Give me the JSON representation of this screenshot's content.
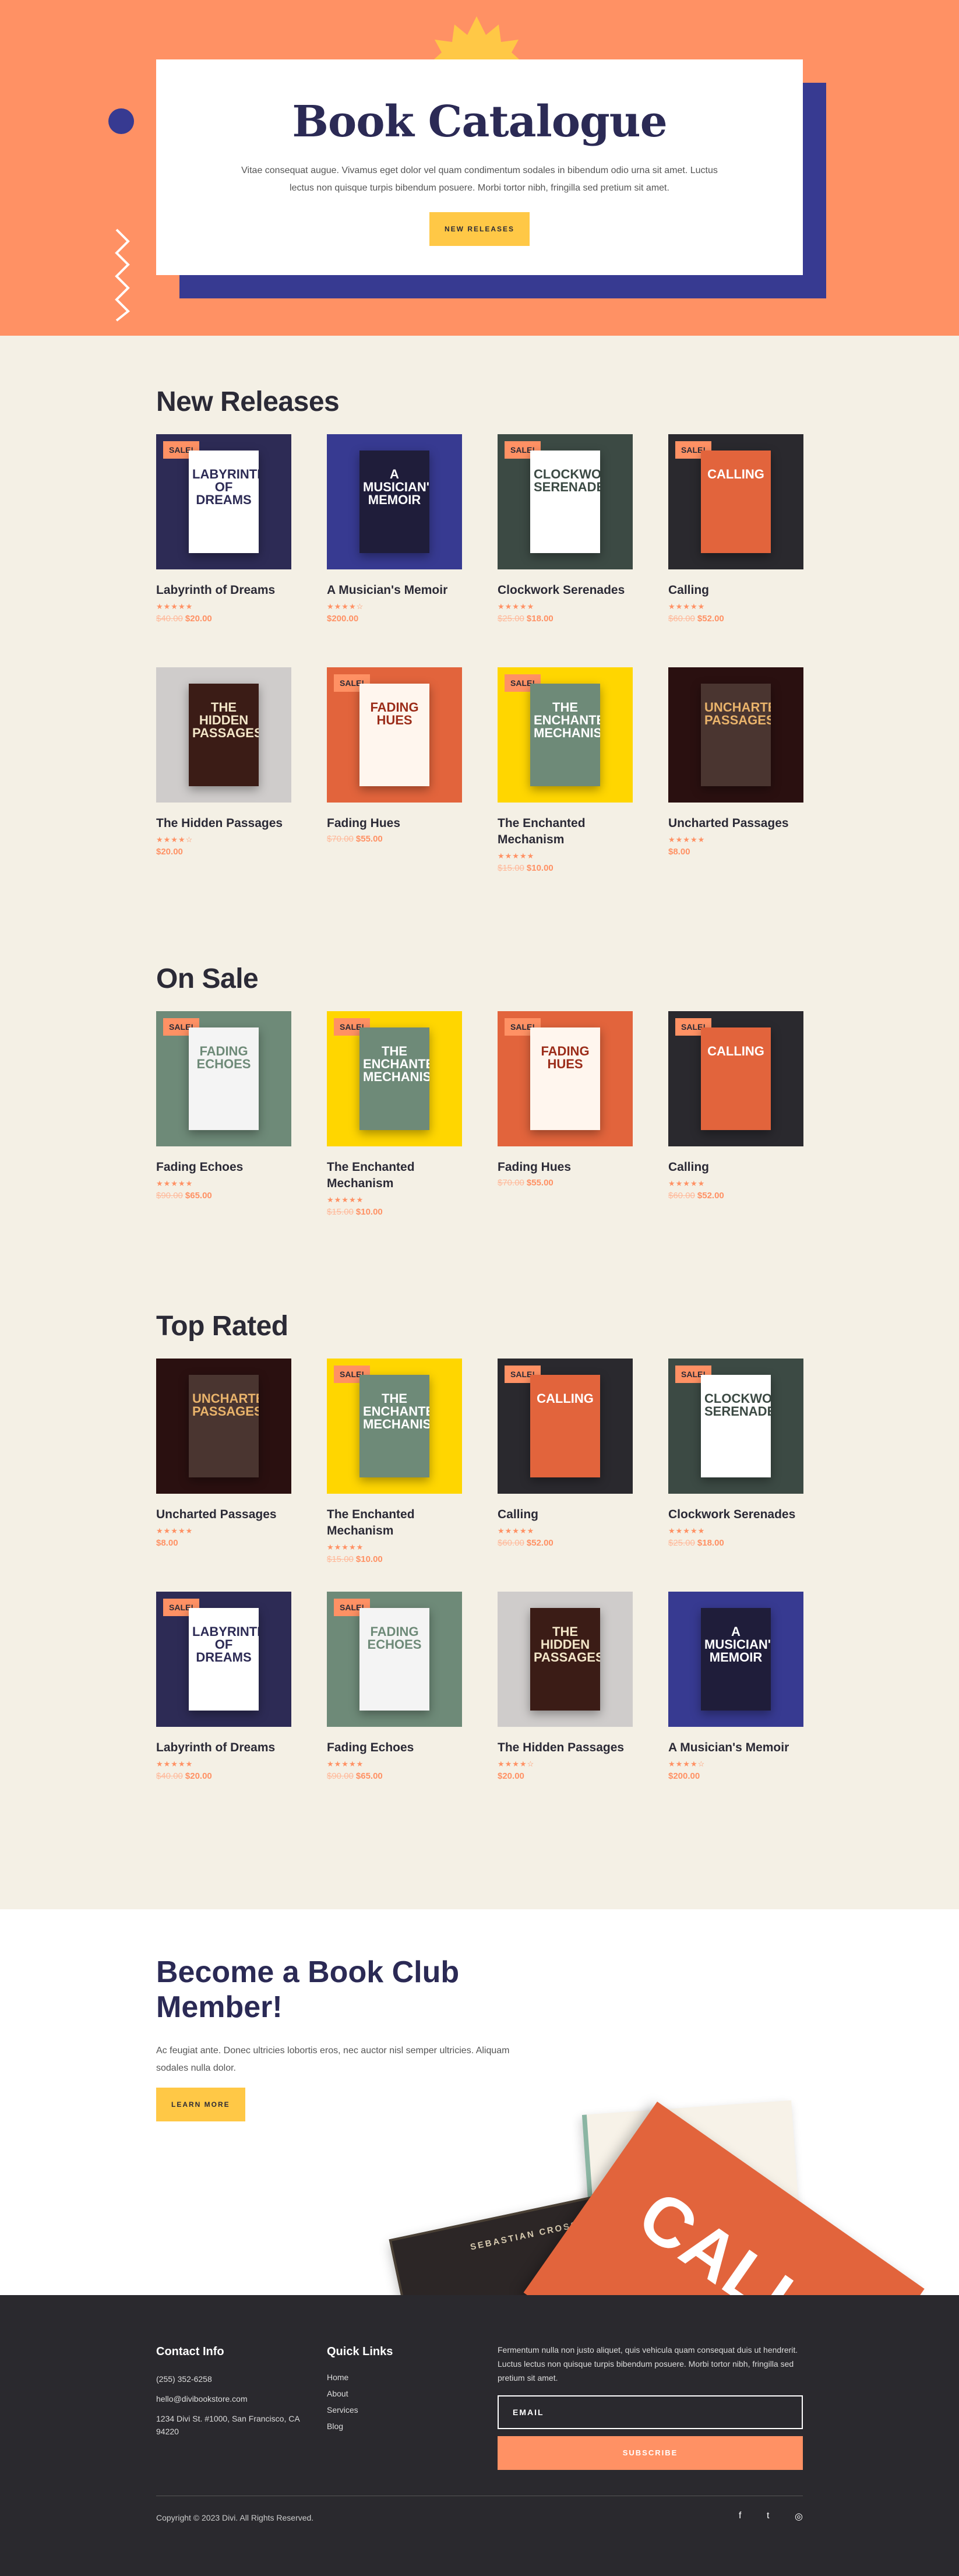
{
  "hero": {
    "title": "Book Catalogue",
    "text": "Vitae consequat augue. Vivamus eget dolor vel quam condimentum sodales in bibendum odio urna sit amet. Luctus lectus non quisque turpis bibendum posuere. Morbi tortor nibh, fringilla sed pretium sit amet.",
    "button": "NEW RELEASES"
  },
  "sale_label": "SALE!",
  "sections": [
    {
      "title": "New Releases",
      "products": [
        {
          "title": "Labyrinth of Dreams",
          "cover": "Labyrinth Of Dreams",
          "bg": "#2d2b55",
          "book": "#ffffff",
          "ink": "#2d2b55",
          "sale": true,
          "stars": "★★★★★",
          "old": "$40.00",
          "price": "$20.00"
        },
        {
          "title": "A Musician's Memoir",
          "cover": "A Musician's Memoir",
          "bg": "#373a91",
          "book": "#1f1d3a",
          "ink": "#ffffff",
          "sale": false,
          "stars": "★★★★☆",
          "old": "",
          "price": "$200.00"
        },
        {
          "title": "Clockwork Serenades",
          "cover": "Clockwork Serenades",
          "bg": "#3c4a44",
          "book": "#ffffff",
          "ink": "#3c4a44",
          "sale": true,
          "stars": "★★★★★",
          "old": "$25.00",
          "price": "$18.00"
        },
        {
          "title": "Calling",
          "cover": "Calling",
          "bg": "#2a292e",
          "book": "#e2643c",
          "ink": "#ffffff",
          "sale": true,
          "stars": "★★★★★",
          "old": "$60.00",
          "price": "$52.00"
        },
        {
          "title": "The Hidden Passages",
          "cover": "The Hidden Passages",
          "bg": "#cfcccb",
          "book": "#3b1c16",
          "ink": "#f3e6c8",
          "sale": false,
          "stars": "★★★★☆",
          "old": "",
          "price": "$20.00"
        },
        {
          "title": "Fading Hues",
          "cover": "Fading Hues",
          "bg": "#e2643c",
          "book": "#fff6ee",
          "ink": "#9b2d1a",
          "sale": true,
          "stars": "",
          "old": "$70.00",
          "price": "$55.00"
        },
        {
          "title": "The Enchanted Mechanism",
          "cover": "The Enchanted Mechanism",
          "bg": "#ffd600",
          "book": "#6e8a78",
          "ink": "#ffffff",
          "sale": true,
          "stars": "★★★★★",
          "old": "$15.00",
          "price": "$10.00"
        },
        {
          "title": "Uncharted Passages",
          "cover": "Uncharted Passages",
          "bg": "#2a1010",
          "book": "#4a3530",
          "ink": "#e9b36b",
          "sale": false,
          "stars": "★★★★★",
          "old": "",
          "price": "$8.00"
        }
      ]
    },
    {
      "title": "On Sale",
      "products": [
        {
          "title": "Fading Echoes",
          "cover": "Fading Echoes",
          "bg": "#6e8a78",
          "book": "#f4f4f4",
          "ink": "#6e8a78",
          "sale": true,
          "stars": "★★★★★",
          "old": "$90.00",
          "price": "$65.00"
        },
        {
          "title": "The Enchanted Mechanism",
          "cover": "The Enchanted Mechanism",
          "bg": "#ffd600",
          "book": "#6e8a78",
          "ink": "#ffffff",
          "sale": true,
          "stars": "★★★★★",
          "old": "$15.00",
          "price": "$10.00"
        },
        {
          "title": "Fading Hues",
          "cover": "Fading Hues",
          "bg": "#e2643c",
          "book": "#fff6ee",
          "ink": "#9b2d1a",
          "sale": true,
          "stars": "",
          "old": "$70.00",
          "price": "$55.00"
        },
        {
          "title": "Calling",
          "cover": "Calling",
          "bg": "#2a292e",
          "book": "#e2643c",
          "ink": "#ffffff",
          "sale": true,
          "stars": "★★★★★",
          "old": "$60.00",
          "price": "$52.00"
        }
      ]
    },
    {
      "title": "Top Rated",
      "products": [
        {
          "title": "Uncharted Passages",
          "cover": "Uncharted Passages",
          "bg": "#2a1010",
          "book": "#4a3530",
          "ink": "#e9b36b",
          "sale": false,
          "stars": "★★★★★",
          "old": "",
          "price": "$8.00"
        },
        {
          "title": "The Enchanted Mechanism",
          "cover": "The Enchanted Mechanism",
          "bg": "#ffd600",
          "book": "#6e8a78",
          "ink": "#ffffff",
          "sale": true,
          "stars": "★★★★★",
          "old": "$15.00",
          "price": "$10.00"
        },
        {
          "title": "Calling",
          "cover": "Calling",
          "bg": "#2a292e",
          "book": "#e2643c",
          "ink": "#ffffff",
          "sale": true,
          "stars": "★★★★★",
          "old": "$60.00",
          "price": "$52.00"
        },
        {
          "title": "Clockwork Serenades",
          "cover": "Clockwork Serenades",
          "bg": "#3c4a44",
          "book": "#ffffff",
          "ink": "#3c4a44",
          "sale": true,
          "stars": "★★★★★",
          "old": "$25.00",
          "price": "$18.00"
        },
        {
          "title": "Labyrinth of Dreams",
          "cover": "Labyrinth Of Dreams",
          "bg": "#2d2b55",
          "book": "#ffffff",
          "ink": "#2d2b55",
          "sale": true,
          "stars": "★★★★★",
          "old": "$40.00",
          "price": "$20.00"
        },
        {
          "title": "Fading Echoes",
          "cover": "Fading Echoes",
          "bg": "#6e8a78",
          "book": "#f4f4f4",
          "ink": "#6e8a78",
          "sale": true,
          "stars": "★★★★★",
          "old": "$90.00",
          "price": "$65.00"
        },
        {
          "title": "The Hidden Passages",
          "cover": "The Hidden Passages",
          "bg": "#cfcccb",
          "book": "#3b1c16",
          "ink": "#f3e6c8",
          "sale": false,
          "stars": "★★★★☆",
          "old": "",
          "price": "$20.00"
        },
        {
          "title": "A Musician's Memoir",
          "cover": "A Musician's Memoir",
          "bg": "#373a91",
          "book": "#1f1d3a",
          "ink": "#ffffff",
          "sale": false,
          "stars": "★★★★☆",
          "old": "",
          "price": "$200.00"
        }
      ]
    }
  ],
  "club": {
    "title": "Become a Book Club Member!",
    "text": "Ac feugiat ante. Donec ultricies lobortis eros, nec auctor nisl semper ultricies. Aliquam sodales nulla dolor.",
    "button": "LEARN MORE",
    "book_red": "CALLING",
    "book_dark": "SEBASTIAN CROSS"
  },
  "footer": {
    "contact_title": "Contact Info",
    "phone": "(255) 352-6258",
    "email": "hello@divibookstore.com",
    "address": "1234 Divi St. #1000, San Francisco, CA 94220",
    "links_title": "Quick Links",
    "links": [
      "Home",
      "About",
      "Services",
      "Blog"
    ],
    "news_text": "Fermentum nulla non justo aliquet, quis vehicula quam consequat duis ut hendrerit. Luctus lectus non quisque turpis bibendum posuere. Morbi tortor nibh, fringilla sed pretium sit amet.",
    "email_placeholder": "EMAIL",
    "subscribe": "SUBSCRIBE",
    "copyright": "Copyright © 2023 Divi. All Rights Reserved.",
    "social": [
      "f",
      "t",
      "◎"
    ],
    "colors": {
      "accent": "#ff9164",
      "navy": "#373a91",
      "yellow": "#ffc846",
      "dark": "#2a292e"
    }
  }
}
